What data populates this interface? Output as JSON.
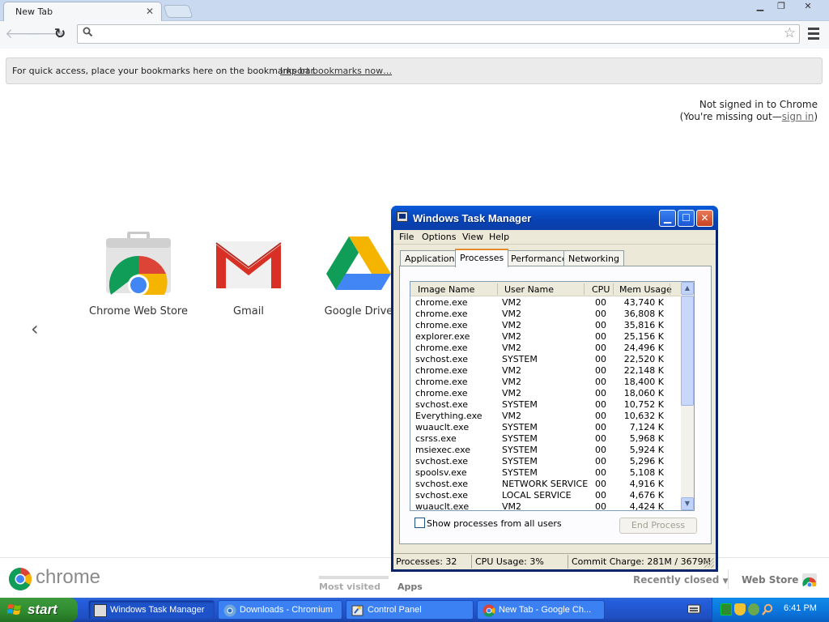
{
  "browser": {
    "tab_title": "New Tab",
    "bookmarks_bar": {
      "message": "For quick access, place your bookmarks here on the bookmarks bar.",
      "import_link": "Import bookmarks now…"
    },
    "signin": {
      "line1": "Not signed in to Chrome",
      "line2_prefix": "(You're missing out—",
      "link": "sign in",
      "line2_suffix": ")"
    },
    "apps": [
      {
        "name": "Chrome Web Store",
        "icon": "chrome-web-store-icon"
      },
      {
        "name": "Gmail",
        "icon": "gmail-icon"
      },
      {
        "name": "Google Drive",
        "icon": "google-drive-icon"
      }
    ],
    "footer": {
      "logo_text": "chrome",
      "most_visited": "Most visited",
      "apps": "Apps",
      "recently_closed": "Recently closed",
      "web_store": "Web Store"
    }
  },
  "task_manager": {
    "title": "Windows Task Manager",
    "menu": [
      "File",
      "Options",
      "View",
      "Help"
    ],
    "tabs": [
      "Applications",
      "Processes",
      "Performance",
      "Networking"
    ],
    "active_tab": "Processes",
    "columns": [
      "Image Name",
      "User Name",
      "CPU",
      "Mem Usage"
    ],
    "processes": [
      {
        "image": "chrome.exe",
        "user": "VM2",
        "cpu": "00",
        "mem": "43,740 K"
      },
      {
        "image": "chrome.exe",
        "user": "VM2",
        "cpu": "00",
        "mem": "36,808 K"
      },
      {
        "image": "chrome.exe",
        "user": "VM2",
        "cpu": "00",
        "mem": "35,816 K"
      },
      {
        "image": "explorer.exe",
        "user": "VM2",
        "cpu": "00",
        "mem": "25,156 K"
      },
      {
        "image": "chrome.exe",
        "user": "VM2",
        "cpu": "00",
        "mem": "24,496 K"
      },
      {
        "image": "svchost.exe",
        "user": "SYSTEM",
        "cpu": "00",
        "mem": "22,520 K"
      },
      {
        "image": "chrome.exe",
        "user": "VM2",
        "cpu": "00",
        "mem": "22,148 K"
      },
      {
        "image": "chrome.exe",
        "user": "VM2",
        "cpu": "00",
        "mem": "18,400 K"
      },
      {
        "image": "chrome.exe",
        "user": "VM2",
        "cpu": "00",
        "mem": "18,060 K"
      },
      {
        "image": "svchost.exe",
        "user": "SYSTEM",
        "cpu": "00",
        "mem": "10,752 K"
      },
      {
        "image": "Everything.exe",
        "user": "VM2",
        "cpu": "00",
        "mem": "10,632 K"
      },
      {
        "image": "wuauclt.exe",
        "user": "SYSTEM",
        "cpu": "00",
        "mem": "7,124 K"
      },
      {
        "image": "csrss.exe",
        "user": "SYSTEM",
        "cpu": "00",
        "mem": "5,968 K"
      },
      {
        "image": "msiexec.exe",
        "user": "SYSTEM",
        "cpu": "00",
        "mem": "5,924 K"
      },
      {
        "image": "svchost.exe",
        "user": "SYSTEM",
        "cpu": "00",
        "mem": "5,296 K"
      },
      {
        "image": "spoolsv.exe",
        "user": "SYSTEM",
        "cpu": "00",
        "mem": "5,108 K"
      },
      {
        "image": "svchost.exe",
        "user": "NETWORK SERVICE",
        "cpu": "00",
        "mem": "4,916 K"
      },
      {
        "image": "svchost.exe",
        "user": "LOCAL SERVICE",
        "cpu": "00",
        "mem": "4,676 K"
      },
      {
        "image": "wuauclt.exe",
        "user": "VM2",
        "cpu": "00",
        "mem": "4,424 K"
      }
    ],
    "show_all_label": "Show processes from all users",
    "show_all_checked": false,
    "end_process_label": "End Process",
    "status": {
      "processes": "Processes: 32",
      "cpu": "CPU Usage: 3%",
      "commit": "Commit Charge: 281M / 3679M"
    }
  },
  "taskbar": {
    "start_label": "start",
    "tasks": [
      {
        "label": "Windows Task Manager",
        "active": true
      },
      {
        "label": "Downloads - Chromium",
        "active": false
      },
      {
        "label": "Control Panel",
        "active": false
      },
      {
        "label": "New Tab - Google Ch...",
        "active": false
      }
    ],
    "clock": "6:41 PM"
  }
}
